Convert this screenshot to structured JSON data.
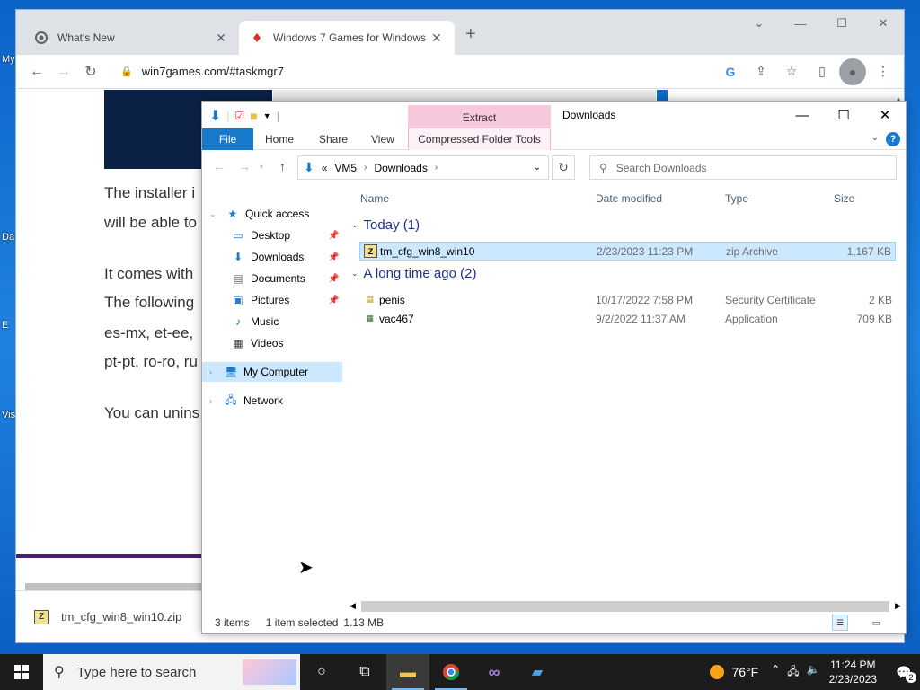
{
  "desktop": {
    "labels": [
      "My",
      "Da",
      "E",
      "Vis"
    ]
  },
  "browser": {
    "tabs": [
      {
        "title": "What's New",
        "icon": "chrome-icon"
      },
      {
        "title": "Windows 7 Games for Windows",
        "icon": "win7games-favicon"
      }
    ],
    "url": "win7games.com/#taskmgr7",
    "page_text": [
      "The installer i",
      "will be able to",
      "It comes with",
      "The following",
      "es-mx, et-ee,",
      "pt-pt, ro-ro, ru",
      "You can unins"
    ],
    "download_file": "tm_cfg_win8_win10.zip"
  },
  "explorer": {
    "title": "Downloads",
    "context_tab_header": "Extract",
    "ribbon_tabs": [
      "File",
      "Home",
      "Share",
      "View",
      "Compressed Folder Tools"
    ],
    "breadcrumb": [
      "«",
      "VM5",
      "Downloads"
    ],
    "search_placeholder": "Search Downloads",
    "nav_items": [
      {
        "label": "Quick access",
        "icon": "star-icon"
      },
      {
        "label": "Desktop",
        "icon": "desktop-icon",
        "pinned": true
      },
      {
        "label": "Downloads",
        "icon": "download-icon",
        "pinned": true
      },
      {
        "label": "Documents",
        "icon": "document-icon",
        "pinned": true
      },
      {
        "label": "Pictures",
        "icon": "picture-icon",
        "pinned": true
      },
      {
        "label": "Music",
        "icon": "music-icon"
      },
      {
        "label": "Videos",
        "icon": "video-icon"
      },
      {
        "label": "My Computer",
        "icon": "computer-icon"
      },
      {
        "label": "Network",
        "icon": "network-icon"
      }
    ],
    "columns": [
      "Name",
      "Date modified",
      "Type",
      "Size"
    ],
    "groups": [
      {
        "label": "Today (1)",
        "files": [
          {
            "name": "tm_cfg_win8_win10",
            "date": "2/23/2023 11:23 PM",
            "type": "zip Archive",
            "size": "1,167 KB",
            "selected": true
          }
        ]
      },
      {
        "label": "A long time ago (2)",
        "files": [
          {
            "name": "penis",
            "date": "10/17/2022 7:58 PM",
            "type": "Security Certificate",
            "size": "2 KB"
          },
          {
            "name": "vac467",
            "date": "9/2/2022 11:37 AM",
            "type": "Application",
            "size": "709 KB"
          }
        ]
      }
    ],
    "status": {
      "items": "3 items",
      "selected": "1 item selected",
      "size": "1.13 MB"
    }
  },
  "taskbar": {
    "search_placeholder": "Type here to search",
    "weather": "76°F",
    "time": "11:24 PM",
    "date": "2/23/2023",
    "notifications": "2"
  },
  "colors": {
    "accent": "#1979ca",
    "selection": "#cce8ff",
    "extract_tab": "#f7c7dc",
    "taskbar": "#1c1c1c"
  }
}
